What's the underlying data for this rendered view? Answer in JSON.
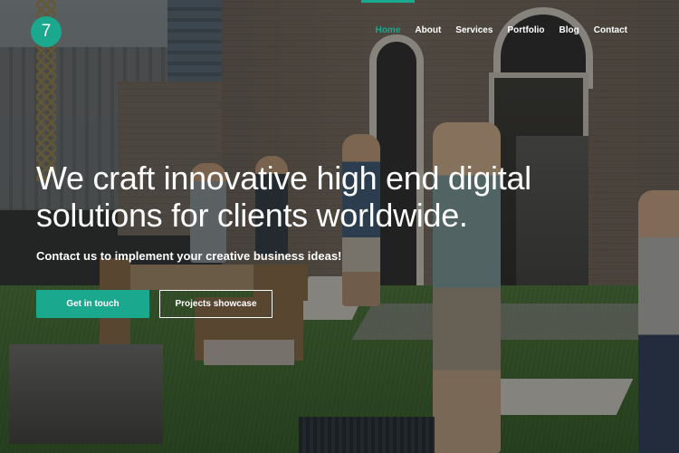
{
  "brand": {
    "logo_text": "7",
    "accent_color": "#1aa88f"
  },
  "nav": {
    "items": [
      {
        "label": "Home",
        "active": true
      },
      {
        "label": "About",
        "active": false
      },
      {
        "label": "Services",
        "active": false
      },
      {
        "label": "Portfolio",
        "active": false
      },
      {
        "label": "Blog",
        "active": false
      },
      {
        "label": "Contact",
        "active": false
      }
    ]
  },
  "hero": {
    "title": "We craft innovative high end digital solutions for clients worldwide.",
    "subtitle": "Contact us to implement your creative business ideas!",
    "primary_button": "Get in touch",
    "secondary_button": "Projects showcase"
  }
}
